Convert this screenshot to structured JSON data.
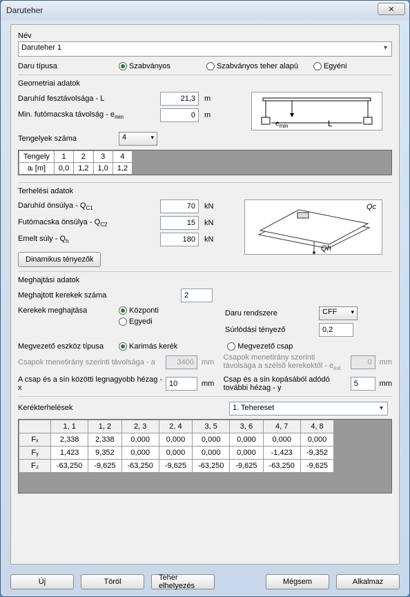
{
  "window": {
    "title": "Daruteher",
    "close": "✕"
  },
  "name": {
    "label": "Név",
    "value": "Daruteher 1"
  },
  "type": {
    "label": "Daru típusa",
    "options": {
      "std": "Szabványos",
      "stdload": "Szabványos teher alapú",
      "custom": "Egyéni"
    },
    "selected": "std"
  },
  "geom": {
    "header": "Geometriai adatok",
    "span_label": "Daruhíd fesztávolsága - L",
    "span_value": "21,3",
    "span_unit": "m",
    "emin_label": "Min. futómacska távolság - e",
    "emin_sub": "min",
    "emin_value": "0",
    "emin_unit": "m",
    "axle_count_label": "Tengelyek száma",
    "axle_count_value": "4",
    "axle_header": "Tengely",
    "axle_row_label": "aᵢ [m]",
    "axle_cols": [
      "1",
      "2",
      "3",
      "4"
    ],
    "axle_vals": [
      "0,0",
      "1,2",
      "1,0",
      "1,2"
    ],
    "diag_emin": "e",
    "diag_emin_sub": "min",
    "diag_L": "L"
  },
  "loads": {
    "header": "Terhelési adatok",
    "qc1_label": "Daruhíd önsúlya - Q",
    "qc1_sub": "C1",
    "qc1_value": "70",
    "qc1_unit": "kN",
    "qc2_label": "Futómacska önsúlya - Q",
    "qc2_sub": "C2",
    "qc2_value": "15",
    "qc2_unit": "kN",
    "qh_label": "Emelt súly - Q",
    "qh_sub": "h",
    "qh_value": "180",
    "qh_unit": "kN",
    "dyn_btn": "Dinamikus tényezők",
    "diag_Qc": "Qc",
    "diag_Qh": "Qh"
  },
  "drive": {
    "header": "Meghajtási adatok",
    "driven_wheels_label": "Meghajtott kerekek száma",
    "driven_wheels_value": "2",
    "wheel_drive_label": "Kerekek meghajtása",
    "wheel_drive_options": {
      "central": "Központi",
      "individual": "Egyedi"
    },
    "wheel_drive_selected": "central",
    "crane_system_label": "Daru rendszere",
    "crane_system_value": "CFF",
    "friction_label": "Súrlódási tényező",
    "friction_value": "0,2",
    "guide_label": "Megvezető eszköz típusa",
    "guide_options": {
      "flanged": "Karimás kerék",
      "pin": "Megvezető csap"
    },
    "guide_selected": "flanged",
    "pin_dist_label": "Csapok menetirány szerinti távolsága - a",
    "pin_dist_value": "3400",
    "pin_dist_unit": "mm",
    "pin_ext_label": "Csapok menetirány szerinti távolsága a szélső kerekektől - e",
    "pin_ext_sub": "ext",
    "pin_ext_value": "0",
    "pin_ext_unit": "mm",
    "gap_x_label": "A csap és a sín közötti legnagyobb hézag - x",
    "gap_x_value": "10",
    "gap_x_unit": "mm",
    "gap_y_label": "Csap és a sín kopásából adódó további hézag - y",
    "gap_y_value": "5",
    "gap_y_unit": "mm"
  },
  "wheel_loads": {
    "header": "Kerékterhelések",
    "case_value": "1. Tehereset",
    "cols": [
      "1, 1",
      "1, 2",
      "2, 3",
      "2, 4",
      "3, 5",
      "3, 6",
      "4, 7",
      "4, 8"
    ],
    "rows": {
      "Fx": [
        "2,338",
        "2,338",
        "0,000",
        "0,000",
        "0,000",
        "0,000",
        "0,000",
        "0,000"
      ],
      "Fy": [
        "1,423",
        "9,352",
        "0,000",
        "0,000",
        "0,000",
        "0,000",
        "-1,423",
        "-9,352"
      ],
      "Fz": [
        "-63,250",
        "-9,625",
        "-63,250",
        "-9,625",
        "-63,250",
        "-9,625",
        "-63,250",
        "-9,625"
      ]
    },
    "row_labels": {
      "Fx": "Fₓ",
      "Fy": "Fᵧ",
      "Fz": "F₂"
    }
  },
  "buttons": {
    "new": "Új",
    "delete": "Töröl",
    "place": "Teher elhelyezés",
    "cancel": "Mégsem",
    "apply": "Alkalmaz"
  }
}
